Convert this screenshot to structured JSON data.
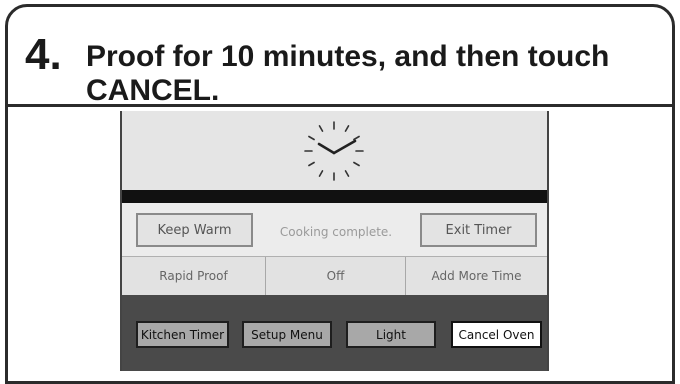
{
  "instruction": {
    "step_number": "4.",
    "text": "Proof for 10 minutes, and then touch CANCEL."
  },
  "display": {
    "clock_icon": "clock-icon",
    "keep_warm_label": "Keep Warm",
    "status_text": "Cooking complete.",
    "exit_timer_label": "Exit Timer",
    "rapid_proof_label": "Rapid Proof",
    "off_label": "Off",
    "add_more_time_label": "Add More Time",
    "kitchen_timer_label": "Kitchen Timer",
    "setup_menu_label": "Setup Menu",
    "light_label": "Light",
    "cancel_oven_label": "Cancel Oven"
  },
  "colors": {
    "outline": "#2b2b2b",
    "screen_bg": "#e6e6e6",
    "control_bar": "#4a4a4a",
    "cancel_button": "#ffffff"
  }
}
